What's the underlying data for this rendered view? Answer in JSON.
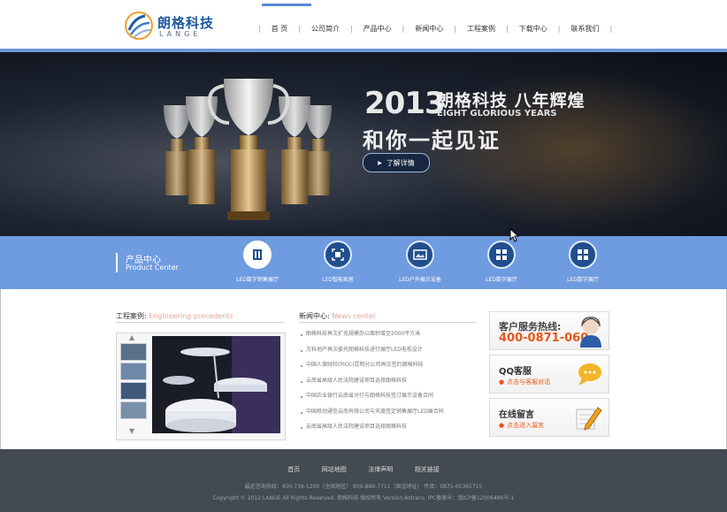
{
  "header": {
    "logo_cn": "朗格科技",
    "logo_en": "LANGE",
    "nav": [
      "首 页",
      "公司简介",
      "产品中心",
      "新闻中心",
      "工程案例",
      "下载中心",
      "联系我们"
    ]
  },
  "banner": {
    "year": "2013",
    "headline": "朗格科技 八年辉煌",
    "subtitle_en": "EIGHT GLORIOUS YEARS",
    "slogan": "和你一起见证",
    "button": "了解详情"
  },
  "products": {
    "title": "产品中心",
    "subtitle": "Product Center",
    "items": [
      {
        "label": "LED数字销售展厅",
        "icon": "film-icon"
      },
      {
        "label": "LED智能家居",
        "icon": "screen-capture-icon"
      },
      {
        "label": "LED户外展示设备",
        "icon": "image-icon"
      },
      {
        "label": "LED数字展厅",
        "icon": "grid-icon"
      },
      {
        "label": "LED数字展厅",
        "icon": "grid-icon"
      }
    ]
  },
  "cases": {
    "title": "工程案例",
    "title_en": "Engineering precedents"
  },
  "news": {
    "title": "新闻中心",
    "title_en": "News center",
    "items": [
      "朗格科技再次扩充规模办公面积增至2000平方米",
      "万科地产再次委托朗格科技进行展厅LED电视设计",
      "中国人保财险(PICC)昆明分公司再次签约朗格科技",
      "云南省高级人民法院建设项目选择朗格科技",
      "中国农业银行云南省分行与朗格科技签订展示设备合同",
      "中国移动通信云南有限公司与天度签定销售展厅LED展合同",
      "云南省高级人民法院建设项目选择朗格科技"
    ]
  },
  "side": {
    "hotline_title": "客户服务热线:",
    "hotline_number": "400-0871-060",
    "qq_title": "QQ客服",
    "qq_link": "点击与客服对话",
    "msg_title": "在线留言",
    "msg_link": "点击进入留言"
  },
  "footer": {
    "nav": [
      "首页",
      "网站地图",
      "法律声明",
      "相关链接"
    ],
    "line1": "最近咨询热线：400-739-1200（全国地区）    800-889-7711（固话地址）    传真：0871-65365715",
    "line2": "Copyright © 2012 LANGE All Rights Reserved. 朗格科技 版权所有  Version:Astrans.      IPC备案号：滇ICP备12006486号-1"
  },
  "colors": {
    "accent": "#6f9be0",
    "dark_blue": "#214e8e",
    "hotline": "#e8561b",
    "footer": "#444a52"
  }
}
